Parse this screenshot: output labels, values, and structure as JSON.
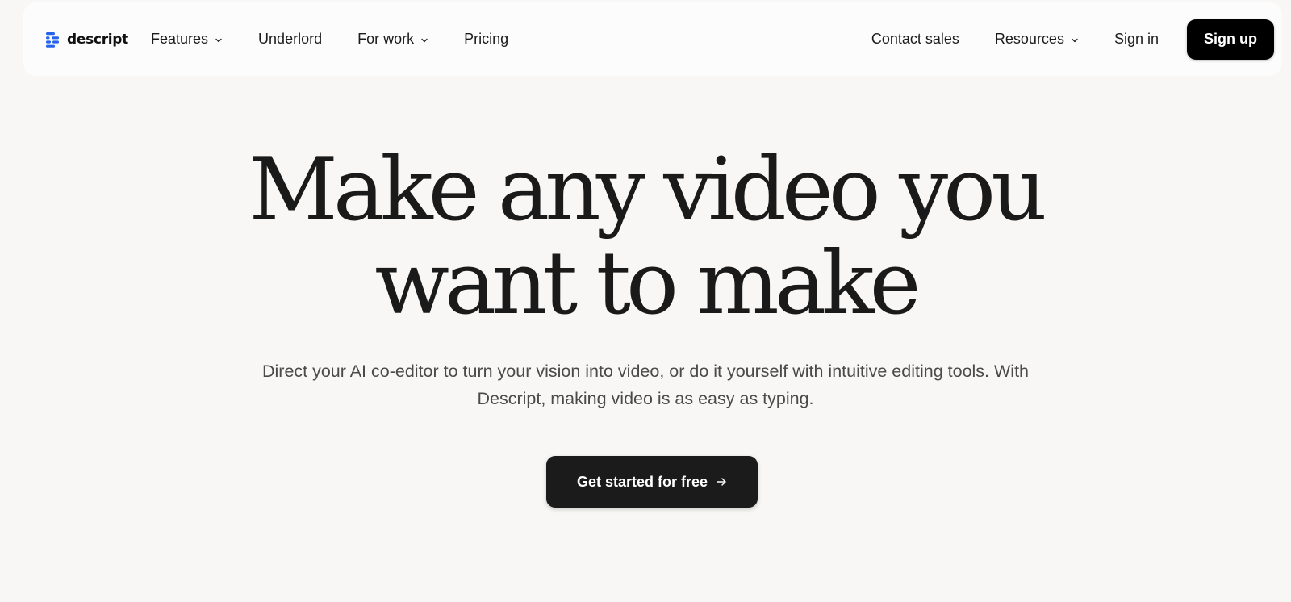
{
  "brand": {
    "name": "descript",
    "logo_icon": "descript-logo-icon",
    "logo_color": "#2563eb"
  },
  "nav": {
    "left": [
      {
        "label": "Features",
        "has_dropdown": true
      },
      {
        "label": "Underlord",
        "has_dropdown": false
      },
      {
        "label": "For work",
        "has_dropdown": true
      },
      {
        "label": "Pricing",
        "has_dropdown": false
      }
    ],
    "right": [
      {
        "label": "Contact sales",
        "has_dropdown": false
      },
      {
        "label": "Resources",
        "has_dropdown": true
      },
      {
        "label": "Sign in",
        "has_dropdown": false
      }
    ],
    "signup_label": "Sign up"
  },
  "hero": {
    "title_line1": "Make any video you",
    "title_line2": "want to make",
    "subtitle": "Direct your AI co-editor to turn your vision into video, or do it yourself with intuitive editing tools. With Descript, making video is as easy as typing.",
    "cta_label": "Get started for free",
    "cta_icon": "arrow-right-icon"
  },
  "colors": {
    "background": "#f8f7f6",
    "navbar": "#fcfcfc",
    "button_dark": "#1b1b1b"
  }
}
